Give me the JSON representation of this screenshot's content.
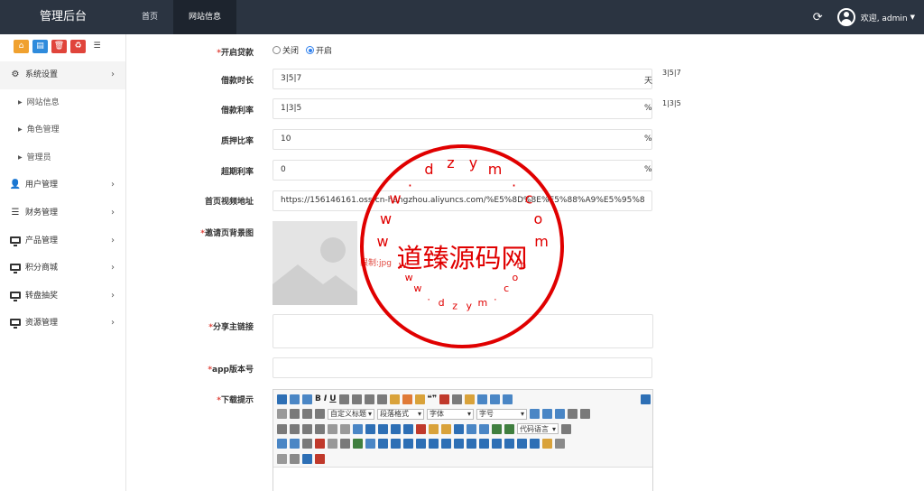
{
  "header": {
    "brand": "管理后台",
    "tabs": [
      {
        "label": "首页",
        "active": false
      },
      {
        "label": "网站信息",
        "active": true
      }
    ],
    "refresh_icon": "refresh-icon",
    "welcome": "欢迎, admin"
  },
  "sidebar": {
    "shortcuts": [
      {
        "icon": "home-icon",
        "color": "#f0a12f"
      },
      {
        "icon": "file-icon",
        "color": "#2f8bdc"
      },
      {
        "icon": "trash-icon",
        "color": "#e0443b"
      },
      {
        "icon": "recycle-icon",
        "color": "#e0443b"
      },
      {
        "icon": "list-icon",
        "color": "#ffffff"
      }
    ],
    "menu": [
      {
        "label": "系统设置",
        "icon": "gears-icon",
        "open": true,
        "children": [
          "网站信息",
          "角色管理",
          "管理员"
        ]
      },
      {
        "label": "用户管理",
        "icon": "user-icon"
      },
      {
        "label": "财务管理",
        "icon": "database-icon"
      },
      {
        "label": "产品管理",
        "icon": "monitor-icon"
      },
      {
        "label": "积分商城",
        "icon": "monitor-icon"
      },
      {
        "label": "转盘抽奖",
        "icon": "monitor-icon"
      },
      {
        "label": "资源管理",
        "icon": "monitor-icon"
      }
    ]
  },
  "form": {
    "loan_enabled": {
      "label": "开启贷款",
      "options": [
        "关闭",
        "开启"
      ],
      "selected": "开启"
    },
    "loan_term": {
      "label": "借款时长",
      "value": "3|5|7",
      "unit": "天",
      "hint": "3|5|7"
    },
    "loan_rate": {
      "label": "借款利率",
      "value": "1|3|5",
      "unit": "%",
      "hint": "1|3|5"
    },
    "pledge_ratio": {
      "label": "质押比率",
      "value": "10",
      "unit": "%"
    },
    "overdue_rate": {
      "label": "超期利率",
      "value": "0",
      "unit": "%"
    },
    "home_video": {
      "label": "首页视频地址",
      "value": "https://156146161.oss-cn-hangzhou.aliyuncs.com/%E5%8D%8E%E5%88%A9%E5%95%8"
    },
    "invite_bg": {
      "label": "邀请页背景图",
      "limit_text": "限制:jpg"
    },
    "share_link": {
      "label": "分享主链接",
      "value": ""
    },
    "app_version": {
      "label": "app版本号",
      "value": ""
    },
    "download_tip": {
      "label": "下载提示"
    }
  },
  "editor": {
    "selects": [
      "自定义标题",
      "段落格式",
      "字体",
      "字号",
      "代码语言"
    ],
    "bold": "B",
    "italic": "I",
    "underline": "U",
    "quote": "❝❞"
  },
  "watermark": {
    "text": "道臻源码网",
    "ring_text": "www.dzym.com"
  },
  "colors": {
    "topbar": "#2b3441",
    "active_tab": "#1d242e",
    "required": "#e0443b",
    "stamp": "#e00000"
  }
}
